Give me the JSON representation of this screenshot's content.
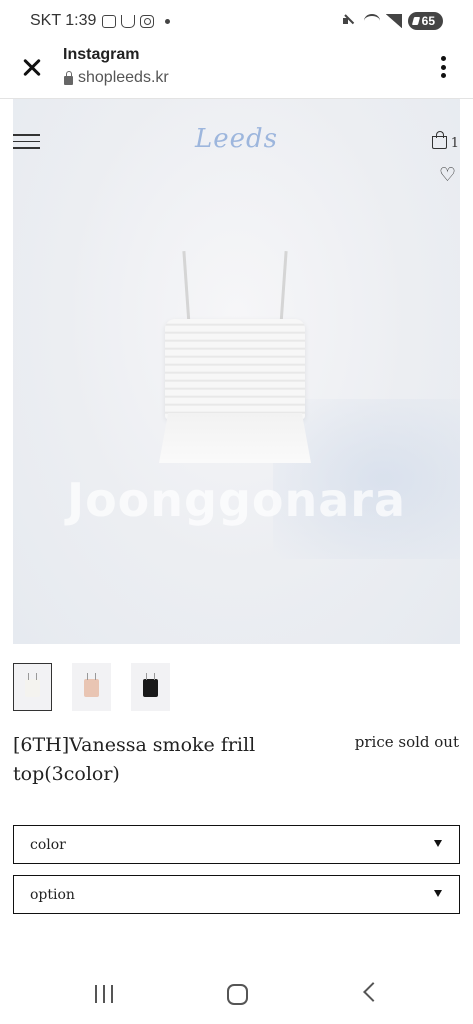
{
  "status_bar": {
    "carrier_time": "SKT 1:39",
    "battery": "65",
    "icons": [
      "gallery-icon",
      "cup-icon",
      "instagram-icon",
      "dot-icon",
      "mute-icon",
      "wifi-icon",
      "signal-icon",
      "battery-icon"
    ]
  },
  "browser": {
    "title": "Instagram",
    "url": "shopleeds.kr",
    "icons": [
      "close-icon",
      "lock-icon",
      "kebab-menu-icon"
    ]
  },
  "site": {
    "logo": "Leeds",
    "cart_count": "1",
    "watermark": "Joonggonara",
    "icons": [
      "hamburger-icon",
      "shopping-bag-icon",
      "heart-icon"
    ]
  },
  "thumbnails": [
    {
      "color": "#f4f3ef",
      "active": true
    },
    {
      "color": "#e9c5b3",
      "active": false
    },
    {
      "color": "#1a1a1a",
      "active": false
    }
  ],
  "product": {
    "title": "[6TH]Vanessa smoke frill top(3color)",
    "price": "price sold out"
  },
  "selects": {
    "color_label": "color",
    "option_label": "option"
  },
  "nav": {
    "icons": [
      "recents-icon",
      "home-icon",
      "back-icon"
    ]
  }
}
